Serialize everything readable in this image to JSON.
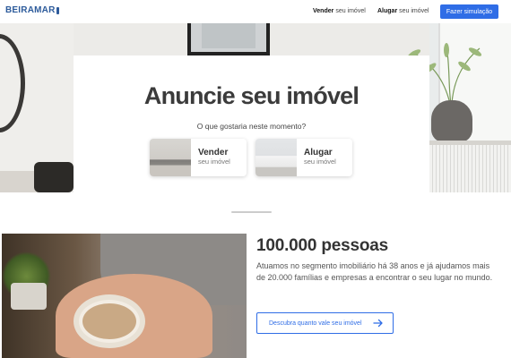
{
  "header": {
    "logo": "BEIRAMAR",
    "nav": [
      {
        "label": "Vender",
        "sub": "seu imóvel"
      },
      {
        "label": "Alugar",
        "sub": "seu imóvel"
      }
    ],
    "cta_label": "Fazer simulação"
  },
  "hero": {
    "title": "Anuncie seu imóvel",
    "subtitle": "O que gostaria neste momento?",
    "options": [
      {
        "label": "Vender",
        "sub": "seu imóvel"
      },
      {
        "label": "Alugar",
        "sub": "seu imóvel"
      }
    ]
  },
  "info": {
    "title": "100.000 pessoas",
    "text": "Atuamos no segmento imobiliário há 38 anos e já ajudamos mais de 20.000 famílias e empresas a encontrar o seu lugar no mundo.",
    "cta_label": "Descubra quanto vale seu imóvel"
  },
  "colors": {
    "accent": "#2f6de6",
    "brand": "#2d5b9b"
  }
}
